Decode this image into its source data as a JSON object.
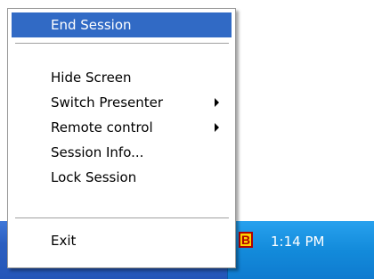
{
  "menu": {
    "items": [
      {
        "label": "End Session"
      },
      {
        "label": "Hide Screen"
      },
      {
        "label": "Switch Presenter"
      },
      {
        "label": "Remote control"
      },
      {
        "label": "Session Info..."
      },
      {
        "label": "Lock Session"
      },
      {
        "label": "Exit"
      }
    ]
  },
  "taskbar": {
    "tray_icon_letter": "B",
    "tray_icon_name": "b-icon",
    "clock": "1:14 PM"
  },
  "colors": {
    "highlight": "#316ac5",
    "taskbar": "#2c5fc0",
    "tray": "#138bdb",
    "tray_icon_bg": "#ffd000",
    "tray_icon_border": "#b00000"
  }
}
